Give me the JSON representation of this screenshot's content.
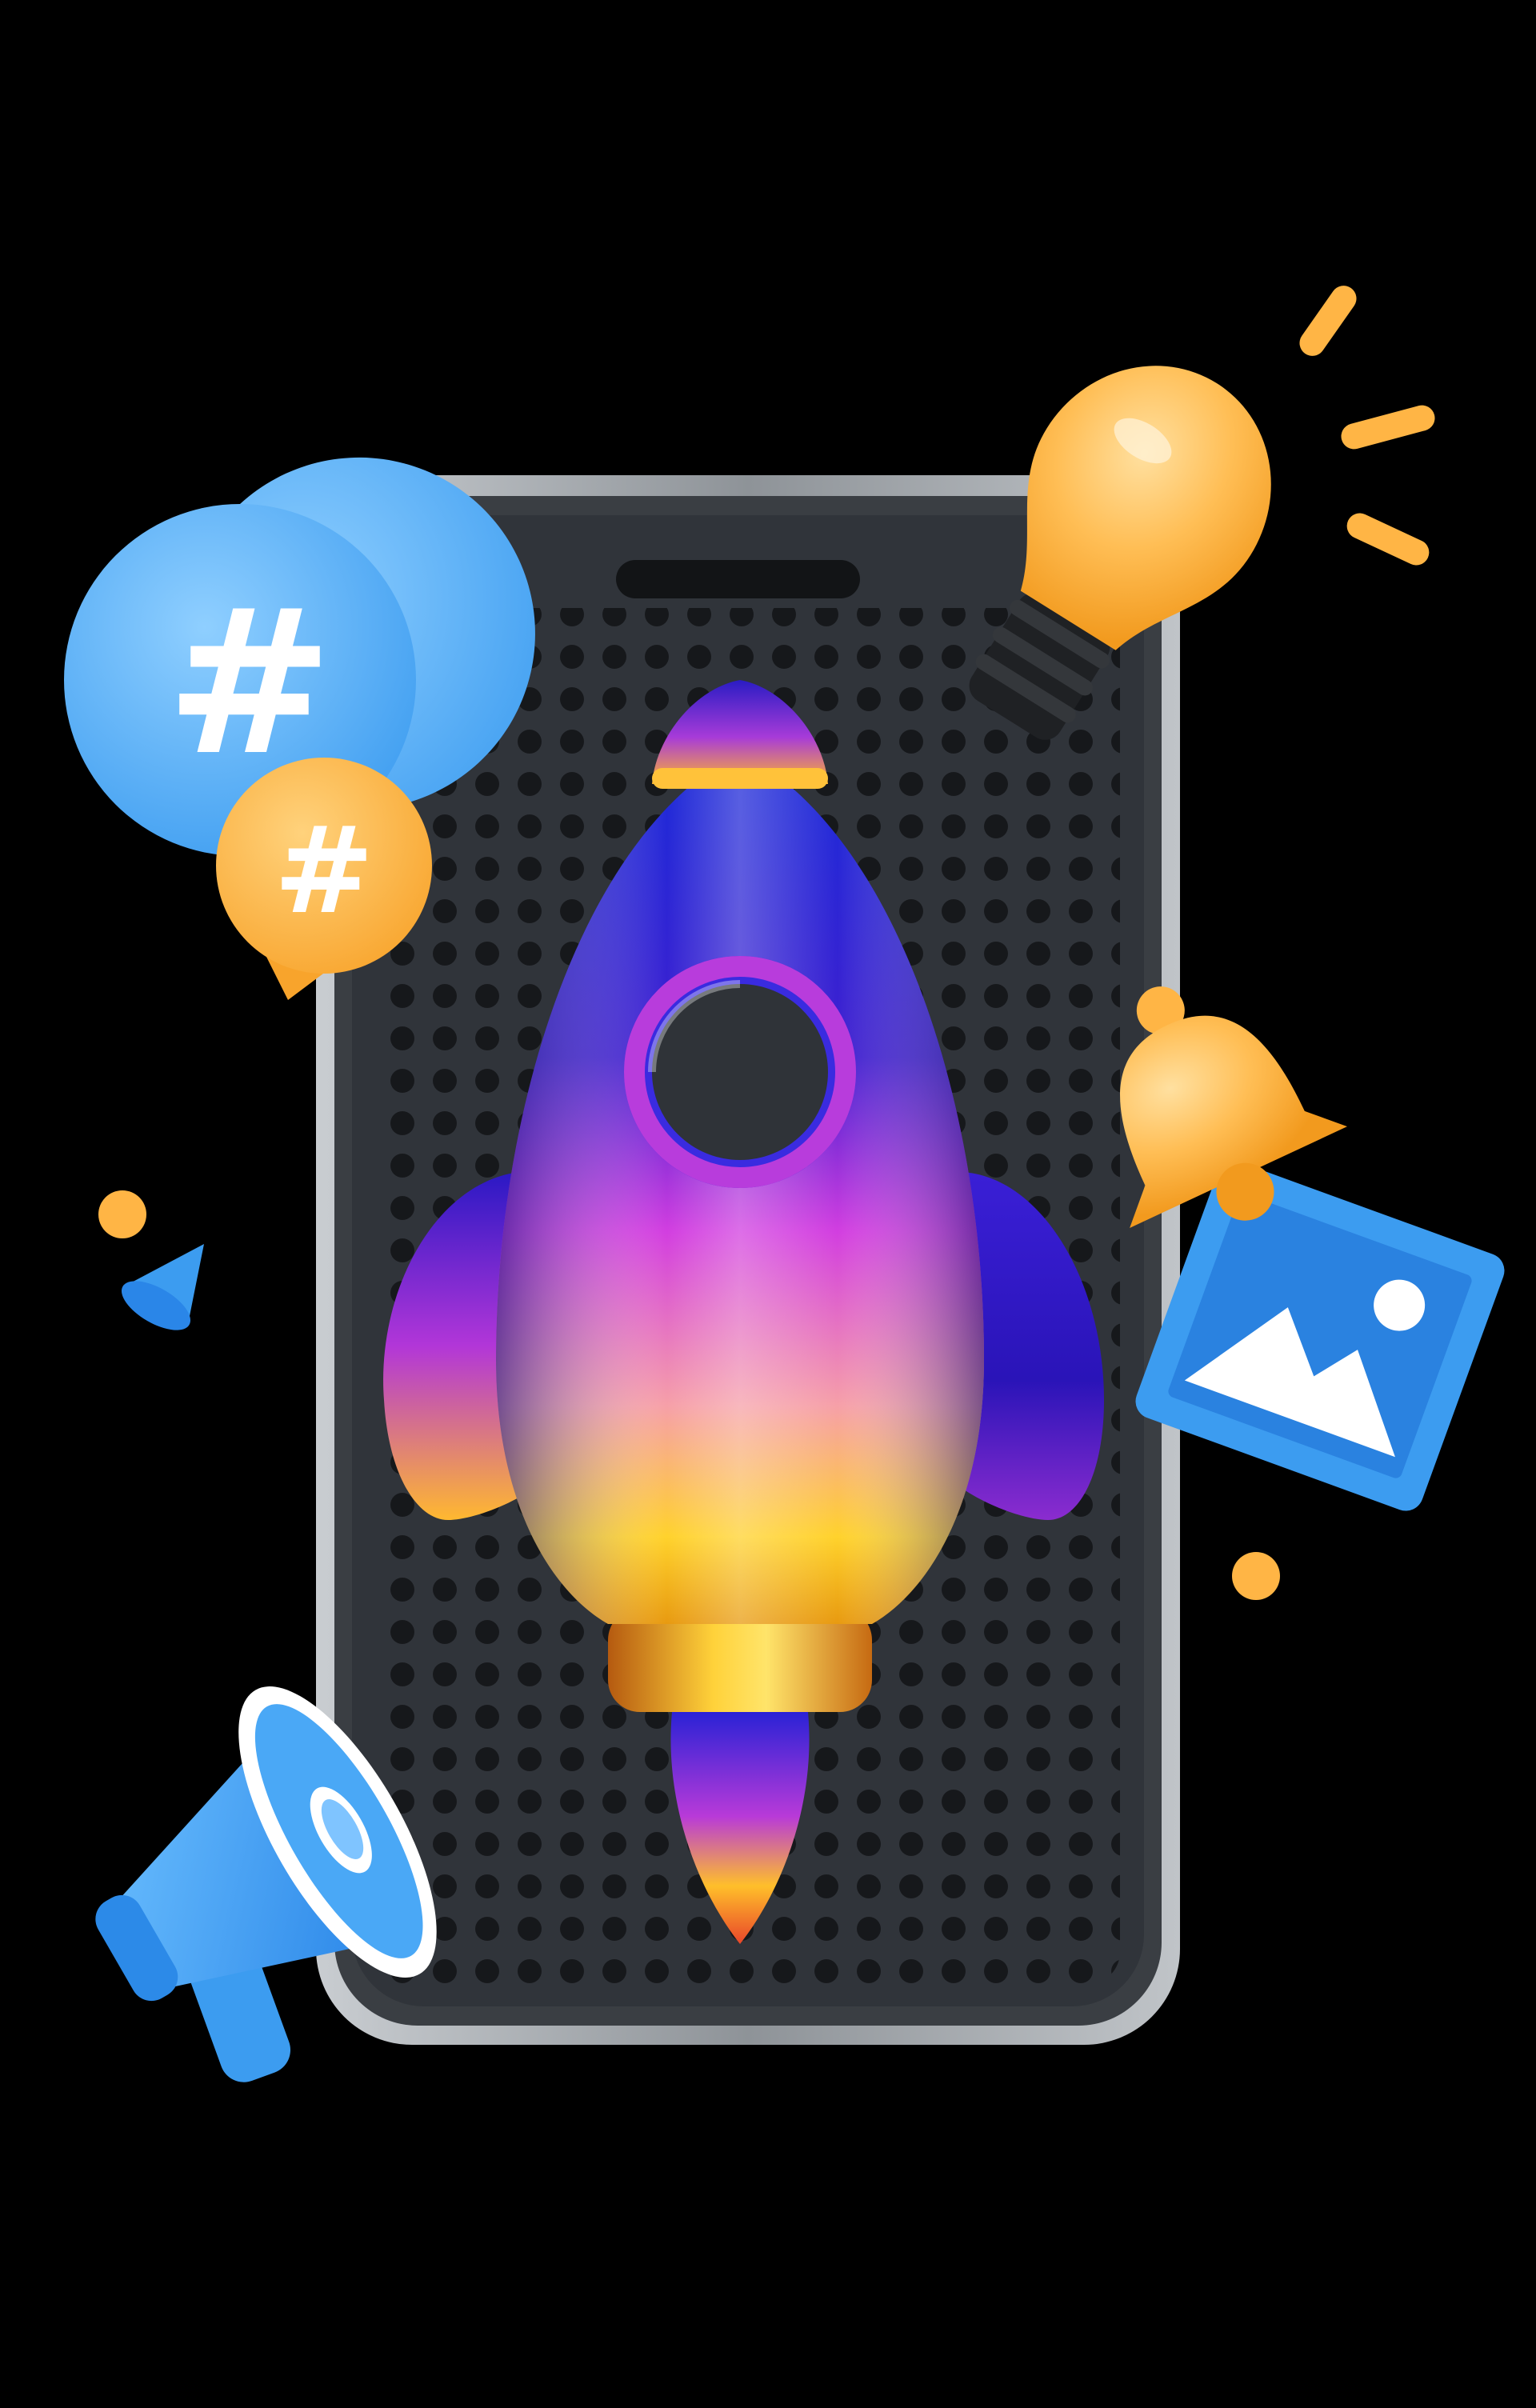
{
  "scene": {
    "background": "#000000",
    "hashtag_symbol": "#",
    "elements": [
      {
        "name": "smartphone",
        "icon": "phone-icon"
      },
      {
        "name": "rocket",
        "icon": "rocket-icon"
      },
      {
        "name": "light-bulb",
        "icon": "lightbulb-icon"
      },
      {
        "name": "hashtag-bubble-blue",
        "icon": "hashtag-icon"
      },
      {
        "name": "hashtag-bubble-orange",
        "icon": "hashtag-icon"
      },
      {
        "name": "notification-bell",
        "icon": "bell-icon"
      },
      {
        "name": "image-card",
        "icon": "image-icon"
      },
      {
        "name": "megaphone",
        "icon": "megaphone-icon"
      }
    ]
  },
  "colors": {
    "phone_frame": "#a7acb1",
    "phone_screen": "#2f3338",
    "blue": "#3c9cf0",
    "orange": "#ffb545",
    "rocket_blue": "#2a1ec8",
    "rocket_magenta": "#c53bd8",
    "rocket_gold": "#ffcc2a"
  }
}
